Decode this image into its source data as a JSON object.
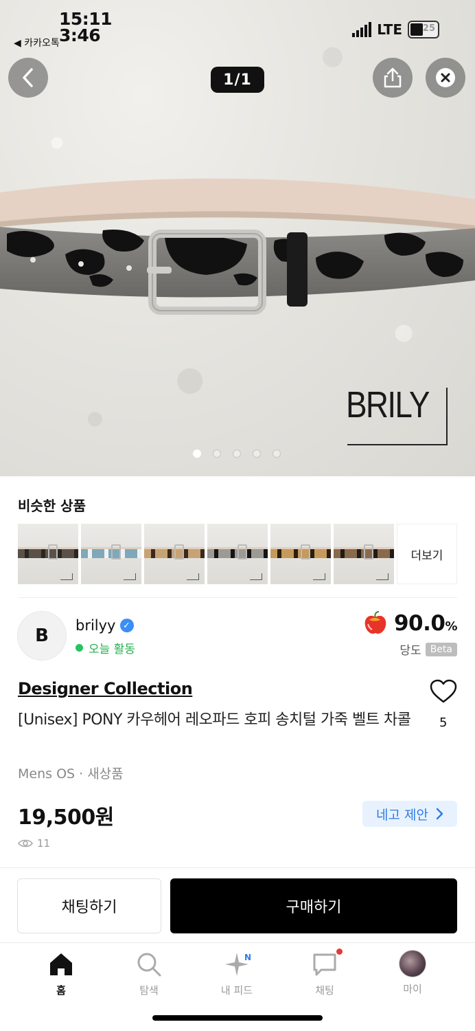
{
  "status_bar": {
    "time_top": "15:11",
    "time_bottom": "3:46",
    "back_app": "◀ 카카오톡",
    "network": "LTE",
    "battery": "25"
  },
  "gallery": {
    "pager": "1/1",
    "watermark": "BRILY",
    "dot_count": 5,
    "active_dot": 0
  },
  "similar": {
    "title": "비슷한 상품",
    "more_label": "더보기",
    "thumbnails": [
      {
        "band": "#5a5248",
        "spot": "#2a2622"
      },
      {
        "band": "#7fa8b8",
        "spot": "#f1f1f1"
      },
      {
        "band": "#c7a374",
        "spot": "#3a2a1c"
      },
      {
        "band": "#9c9a94",
        "spot": "#141414"
      },
      {
        "band": "#c59a5a",
        "spot": "#2b1d10"
      },
      {
        "band": "#8a6a4c",
        "spot": "#221a14"
      }
    ]
  },
  "seller": {
    "avatar_letter": "B",
    "name": "brilyy",
    "activity": "오늘 활동",
    "sweetness_value": "90.0",
    "sweetness_unit": "%",
    "sweetness_label": "당도",
    "beta": "Beta"
  },
  "product": {
    "collection": "Designer Collection",
    "title": "[Unisex] PONY 카우헤어 레오파드 호피 송치털 가죽 벨트 차콜",
    "likes": "5",
    "meta": "Mens OS · 새상품",
    "price": "19,500원",
    "offer_label": "네고 제안",
    "views": "11"
  },
  "actions": {
    "chat": "채팅하기",
    "buy": "구매하기"
  },
  "tabbar": {
    "home": "홈",
    "search": "탐색",
    "feed": "내 피드",
    "feed_badge": "N",
    "chat": "채팅",
    "my": "마이"
  },
  "colors": {
    "accent_blue": "#2f7be5",
    "active_green": "#22b04b",
    "buy_button": "#000000"
  }
}
